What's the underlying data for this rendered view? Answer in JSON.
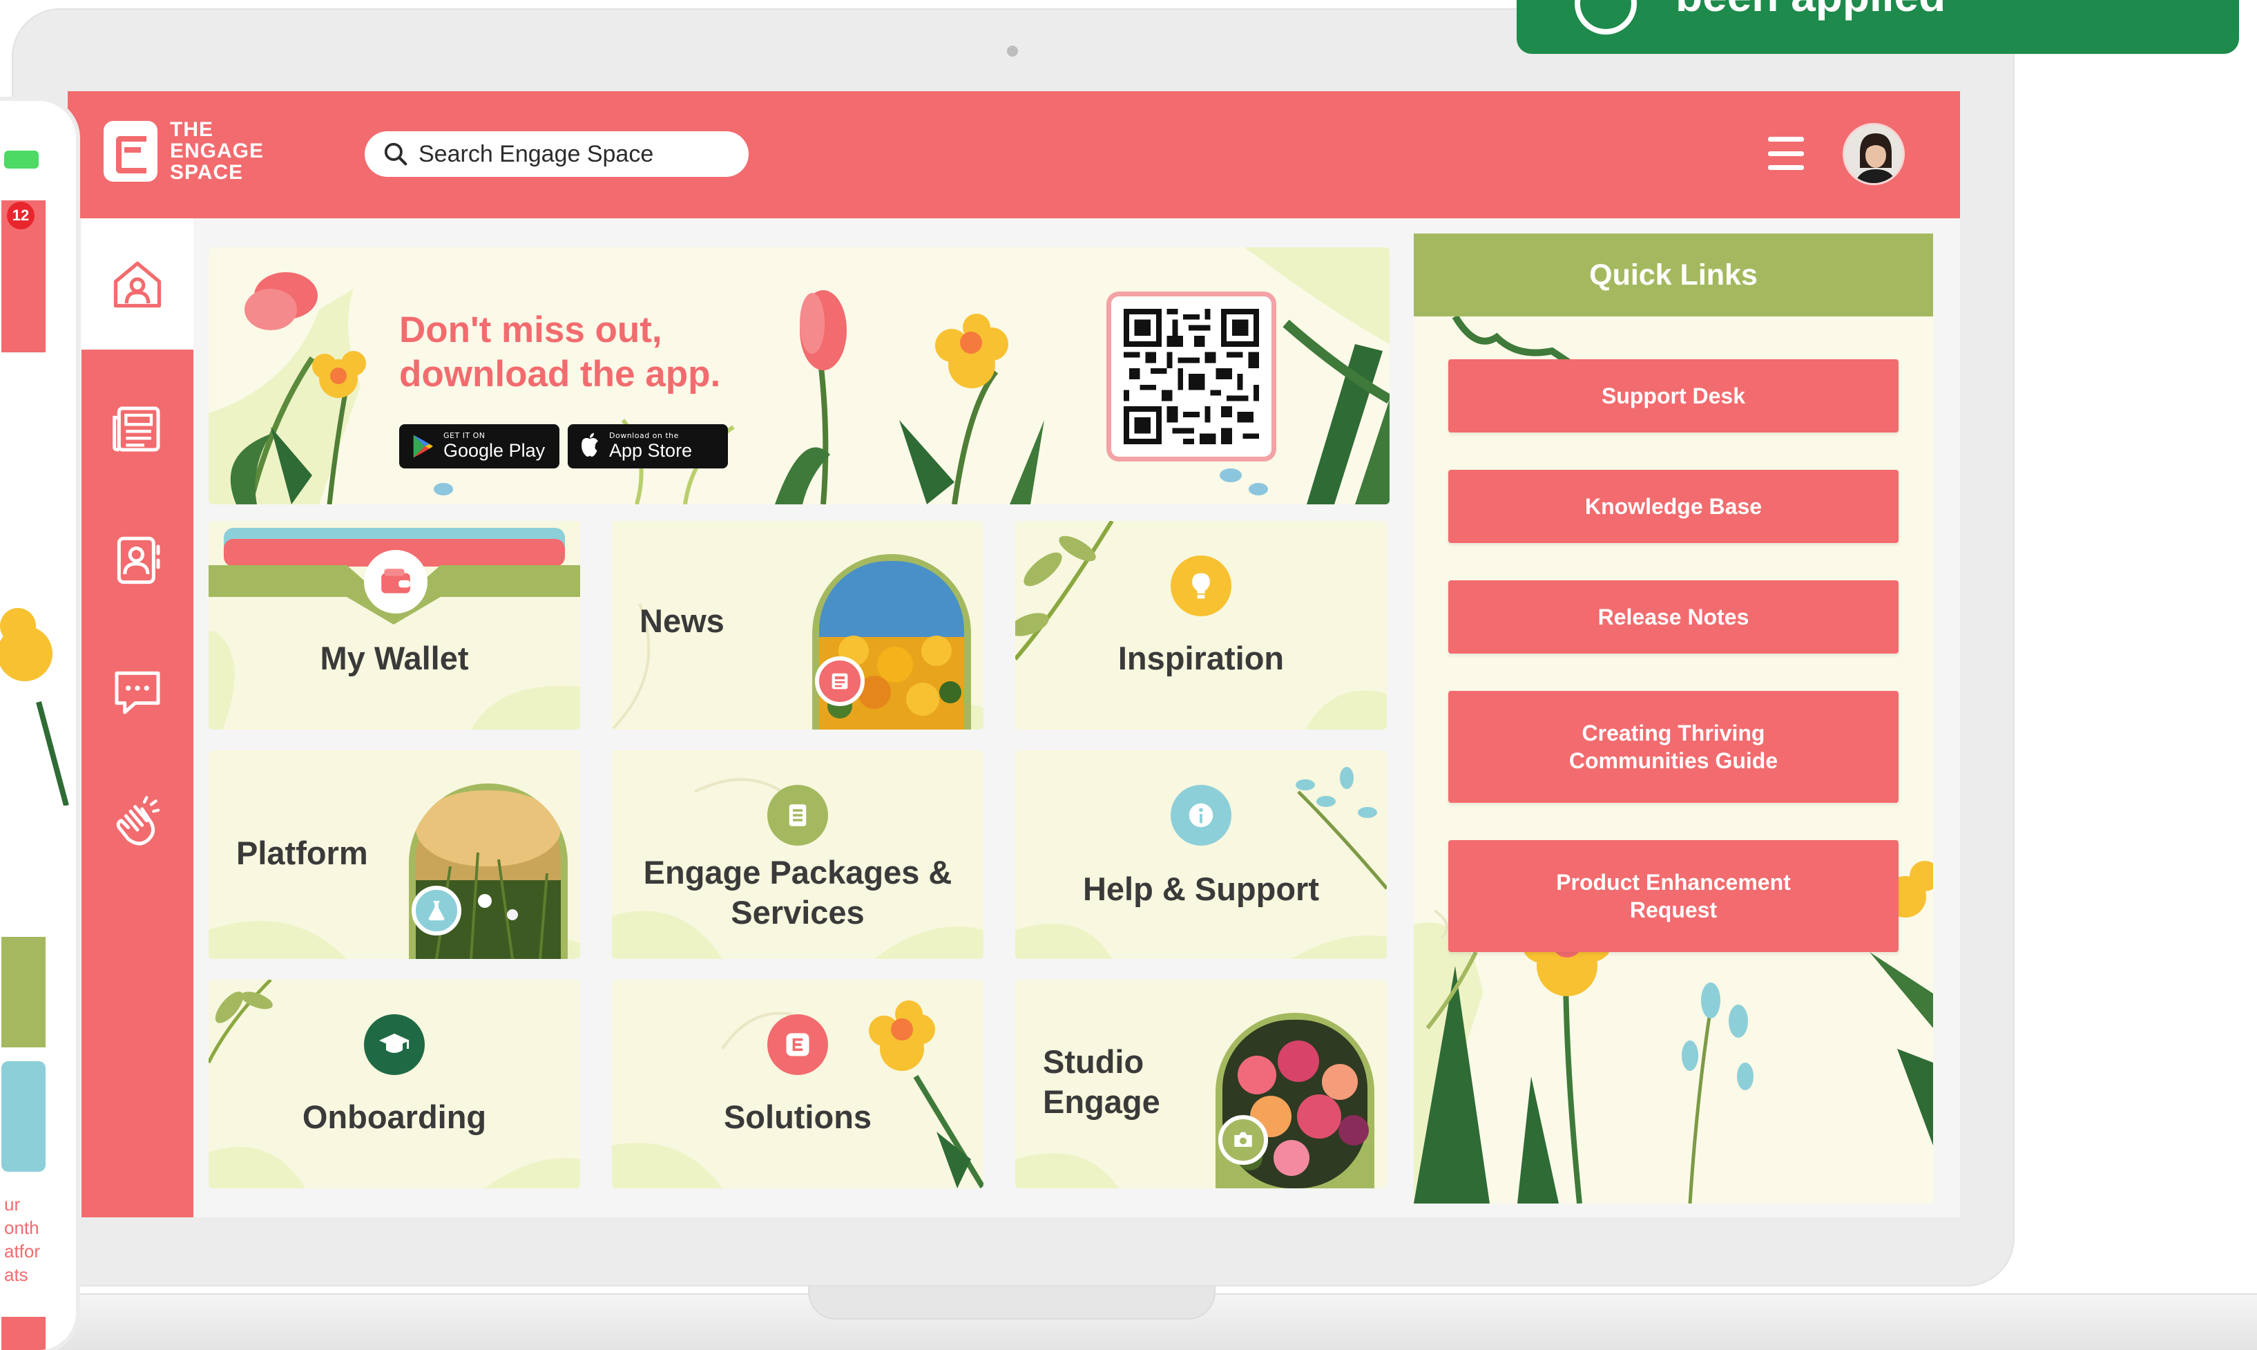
{
  "app": {
    "logo_lines": [
      "THE",
      "ENGAGE",
      "SPACE"
    ]
  },
  "search": {
    "placeholder": "Search Engage Space"
  },
  "colors": {
    "brand_coral": "#f26b6e",
    "quicklinks_green": "#a4b95f",
    "toast_green": "#1e8a4b",
    "tile_cream": "#f8f7df"
  },
  "sidebar": {
    "items": [
      {
        "icon": "home-icon",
        "active": true
      },
      {
        "icon": "newspaper-icon",
        "active": false
      },
      {
        "icon": "contacts-icon",
        "active": false
      },
      {
        "icon": "chat-icon",
        "active": false
      },
      {
        "icon": "clapping-hands-icon",
        "active": false
      }
    ]
  },
  "banner": {
    "title": "Don't miss out, download the app.",
    "google_play_small": "GET IT ON",
    "google_play_big": "Google Play",
    "app_store_small": "Download on the",
    "app_store_big": "App Store"
  },
  "tiles": [
    {
      "label": "My Wallet",
      "icon": "wallet-icon"
    },
    {
      "label": "News",
      "icon": "newspaper-icon"
    },
    {
      "label": "Inspiration",
      "icon": "lightbulb-icon"
    },
    {
      "label": "Platform",
      "icon": "flask-icon"
    },
    {
      "label": "Engage Packages & Services",
      "icon": "document-icon"
    },
    {
      "label": "Help & Support",
      "icon": "info-icon"
    },
    {
      "label": "Onboarding",
      "icon": "graduation-cap-icon"
    },
    {
      "label": "Solutions",
      "icon": "engage-logo-icon"
    },
    {
      "label": "Studio Engage",
      "icon": "camera-icon"
    }
  ],
  "quick_links": {
    "title": "Quick Links",
    "items": [
      "Support Desk",
      "Knowledge Base",
      "Release Notes",
      "Creating Thriving Communities Guide",
      "Product Enhancement Request"
    ]
  },
  "toast": {
    "text": "been applied"
  },
  "phone": {
    "badge_count": "12",
    "text_lines": [
      "ur",
      "onth",
      "atfor",
      "ats"
    ]
  }
}
